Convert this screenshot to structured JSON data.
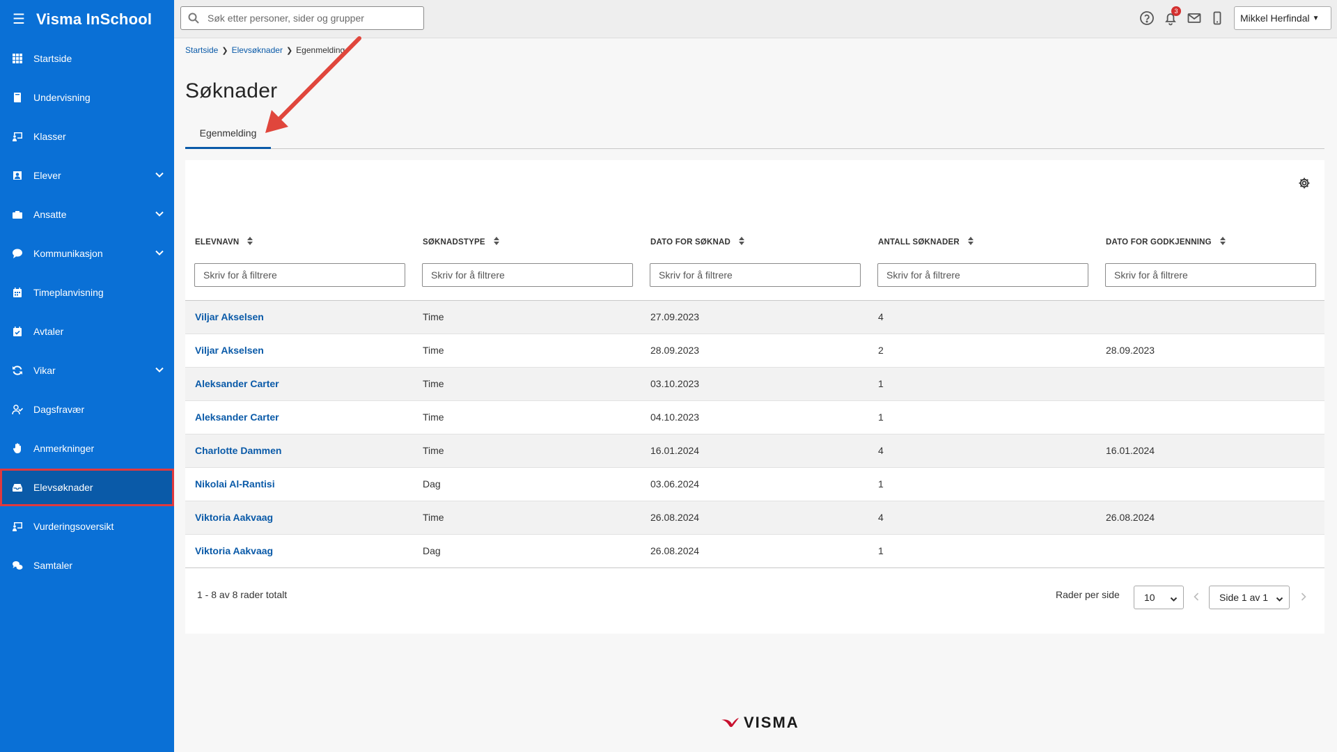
{
  "app": {
    "title": "Visma InSchool",
    "menu_icon": "hamburger-icon"
  },
  "sidebar": {
    "items": [
      {
        "label": "Startside",
        "icon": "grid-icon",
        "expandable": false
      },
      {
        "label": "Undervisning",
        "icon": "book-icon",
        "expandable": false
      },
      {
        "label": "Klasser",
        "icon": "classroom-icon",
        "expandable": false
      },
      {
        "label": "Elever",
        "icon": "student-icon",
        "expandable": true
      },
      {
        "label": "Ansatte",
        "icon": "briefcase-icon",
        "expandable": true
      },
      {
        "label": "Kommunikasjon",
        "icon": "chat-icon",
        "expandable": true
      },
      {
        "label": "Timeplanvisning",
        "icon": "calendar-icon",
        "expandable": false
      },
      {
        "label": "Avtaler",
        "icon": "calendar-check-icon",
        "expandable": false
      },
      {
        "label": "Vikar",
        "icon": "refresh-icon",
        "expandable": true
      },
      {
        "label": "Dagsfravær",
        "icon": "user-check-icon",
        "expandable": false
      },
      {
        "label": "Anmerkninger",
        "icon": "hand-icon",
        "expandable": false
      },
      {
        "label": "Elevsøknader",
        "icon": "inbox-icon",
        "expandable": false,
        "active": true
      },
      {
        "label": "Vurderingsoversikt",
        "icon": "classroom-icon",
        "expandable": false
      },
      {
        "label": "Samtaler",
        "icon": "chat-bubbles-icon",
        "expandable": false
      }
    ]
  },
  "topbar": {
    "search_placeholder": "Søk etter personer, sider og grupper",
    "notification_count": "3",
    "user_name": "Mikkel Herfindal"
  },
  "breadcrumb": {
    "items": [
      "Startside",
      "Elevsøknader",
      "Egenmelding"
    ]
  },
  "page": {
    "title": "Søknader"
  },
  "tabs": [
    {
      "label": "Egenmelding",
      "active": true
    }
  ],
  "table": {
    "columns": [
      "ELEVNAVN",
      "SØKNADSTYPE",
      "DATO FOR SØKNAD",
      "ANTALL SØKNADER",
      "DATO FOR GODKJENNING"
    ],
    "filter_placeholder": "Skriv for å filtrere",
    "rows": [
      [
        "Viljar Akselsen",
        "Time",
        "27.09.2023",
        "4",
        ""
      ],
      [
        "Viljar Akselsen",
        "Time",
        "28.09.2023",
        "2",
        "28.09.2023"
      ],
      [
        "Aleksander Carter",
        "Time",
        "03.10.2023",
        "1",
        ""
      ],
      [
        "Aleksander Carter",
        "Time",
        "04.10.2023",
        "1",
        ""
      ],
      [
        "Charlotte Dammen",
        "Time",
        "16.01.2024",
        "4",
        "16.01.2024"
      ],
      [
        "Nikolai Al-Rantisi",
        "Dag",
        "03.06.2024",
        "1",
        ""
      ],
      [
        "Viktoria Aakvaag",
        "Time",
        "26.08.2024",
        "4",
        "26.08.2024"
      ],
      [
        "Viktoria Aakvaag",
        "Dag",
        "26.08.2024",
        "1",
        ""
      ]
    ]
  },
  "pagination": {
    "summary": "1 - 8 av 8 rader totalt",
    "rows_per_page_label": "Rader per side",
    "rows_per_page_value": "10",
    "page_value": "Side 1 av 1"
  },
  "footer": {
    "logo_text": "VISMA"
  },
  "colors": {
    "sidebar": "#0a70d6",
    "active_item": "#0a5aa8",
    "highlight": "#e0393e",
    "link": "#0a5aa8",
    "annotation_arrow": "#e0463c"
  }
}
